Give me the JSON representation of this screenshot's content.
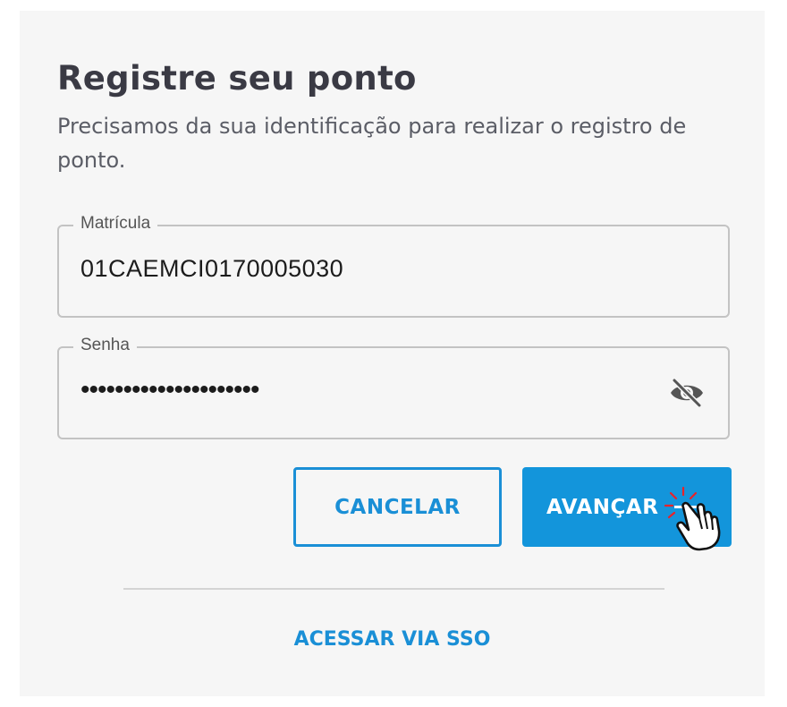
{
  "header": {
    "title": "Registre seu ponto",
    "subtitle": "Precisamos da sua identificação para realizar o registro de ponto."
  },
  "form": {
    "matricula": {
      "label": "Matrícula",
      "value": "01CAEMCI0170005030"
    },
    "senha": {
      "label": "Senha",
      "masked_value": "•••••••••••••••••••••",
      "toggle_icon": "eye-off-icon"
    }
  },
  "actions": {
    "cancel_label": "CANCELAR",
    "next_label": "AVANÇAR",
    "sso_label": "ACESSAR VIA SSO"
  },
  "colors": {
    "accent": "#1395db",
    "accent_text": "#1a8fd6",
    "title": "#3a3a44",
    "background": "#f6f6f6"
  }
}
